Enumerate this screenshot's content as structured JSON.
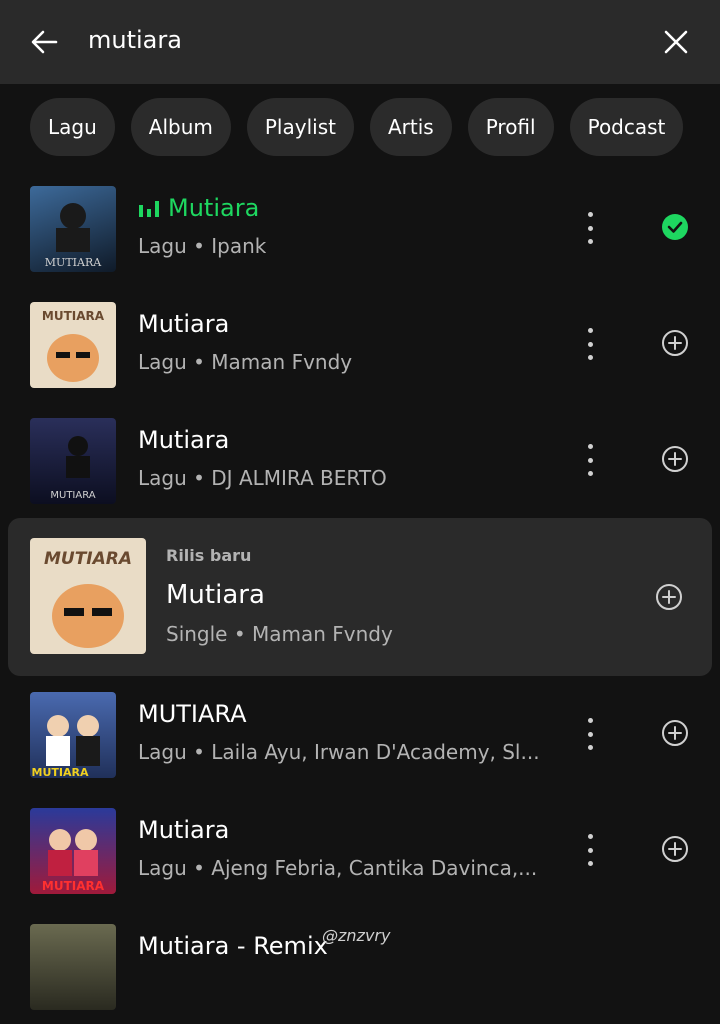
{
  "search": {
    "query": "mutiara"
  },
  "chips": [
    "Lagu",
    "Album",
    "Playlist",
    "Artis",
    "Profil",
    "Podcast"
  ],
  "results": [
    {
      "title": "Mutiara",
      "subtitle": "Lagu • Ipank",
      "thumb_text": "MUTIARA",
      "thumb_color": "#1b2a3c",
      "playing": true,
      "saved": true
    },
    {
      "title": "Mutiara",
      "subtitle": "Lagu • Maman Fvndy",
      "thumb_text": "MUTIARA",
      "thumb_color": "#e9dcc6",
      "playing": false,
      "saved": false
    },
    {
      "title": "Mutiara",
      "subtitle": "Lagu • DJ ALMIRA BERTO",
      "thumb_text": "MUTIARA",
      "thumb_color": "#1a1f3a",
      "playing": false,
      "saved": false
    }
  ],
  "highlight": {
    "label": "Rilis baru",
    "title": "Mutiara",
    "subtitle": "Single • Maman Fvndy",
    "thumb_text": "MUTIARA"
  },
  "results_after": [
    {
      "title": "MUTIARA",
      "subtitle": "Lagu • Laila Ayu, Irwan D'Academy, Sl...",
      "thumb_text": "MUTIARA",
      "thumb_color": "#3a4f8a"
    },
    {
      "title": "Mutiara",
      "subtitle": "Lagu • Ajeng Febria, Cantika Davinca,...",
      "thumb_text": "MUTIARA",
      "thumb_color": "#7a1f3a"
    },
    {
      "title": "Mutiara - Remix",
      "subtitle": "",
      "thumb_text": "",
      "thumb_color": "#3a3a2a"
    }
  ],
  "watermark": "@znzvry",
  "colors": {
    "accent": "#1ed760",
    "background": "#121212",
    "surface": "#2a2a2a",
    "secondary_text": "#b3b3b3"
  }
}
